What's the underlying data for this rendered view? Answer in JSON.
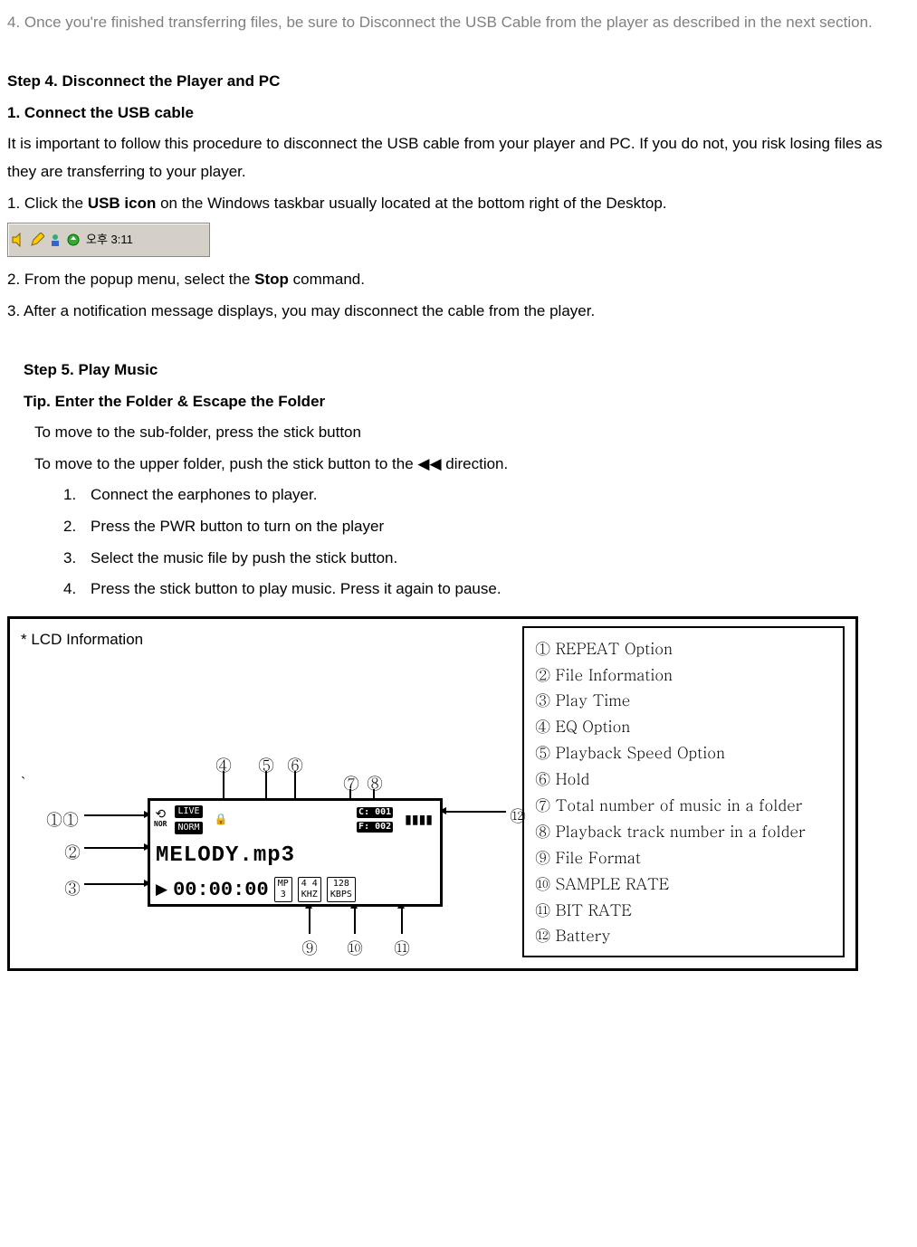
{
  "intro": {
    "num": "4.",
    "text": " Once you're finished transferring files, be sure to Disconnect the USB Cable from the player as described in the next section."
  },
  "step4": {
    "title": "Step 4. Disconnect the Player and PC",
    "sub1": "1. Connect the USB cable",
    "p1": "It is important to follow this procedure to disconnect the USB cable from your player and PC. If you do not, you risk losing files as they are transferring to your player.",
    "li1a": "1. Click the ",
    "li1b": "USB icon",
    "li1c": " on the Windows taskbar usually located at the bottom right of the Desktop.",
    "li2a": "2. From the popup menu, select the ",
    "li2b": "Stop",
    "li2c": " command.",
    "li3": "3. After a notification message displays, you may disconnect the cable from the player."
  },
  "taskbar_time": "오후 3:11",
  "step5": {
    "title": "Step 5. Play Music",
    "tip": "Tip. Enter the Folder & Escape the Folder",
    "move1": "To move to the sub-folder, press the stick button",
    "move2a": "To move to the upper folder, push the stick button to the ",
    "move2b": "◀◀",
    "move2c": " direction.",
    "ol": [
      "Connect the earphones to player.",
      "Press the PWR button to turn on the player",
      "Select the music file by push the stick button.",
      "Press the stick button to play music. Press it again to pause."
    ]
  },
  "lcd": {
    "title": "* LCD Information",
    "filename": "MELODY.mp3",
    "time": "00:00:00",
    "nor": "NOR",
    "live": "LIVE",
    "norm": "NORM",
    "c": "C: 001",
    "f": "F: 002",
    "mp3": "MP\n3",
    "khz": "4 4\nKHZ",
    "kbps": "128\nKBPS",
    "markers_top": [
      "④",
      "⑤",
      "⑥",
      "⑦",
      "⑧"
    ],
    "markers_left": [
      "①①",
      "②",
      "③"
    ],
    "markers_right": [
      "⑫"
    ],
    "markers_bottom": [
      "⑨",
      "⑩",
      "⑪"
    ],
    "legend": [
      "① REPEAT Option",
      "② File Information",
      "③ Play Time",
      "④ EQ Option",
      "⑤ Playback Speed Option",
      "⑥ Hold",
      "⑦ Total number of music in a folder",
      "⑧ Playback track number in a folder",
      "⑨ File Format",
      "⑩ SAMPLE RATE",
      "⑪ BIT RATE",
      "⑫ Battery"
    ]
  }
}
